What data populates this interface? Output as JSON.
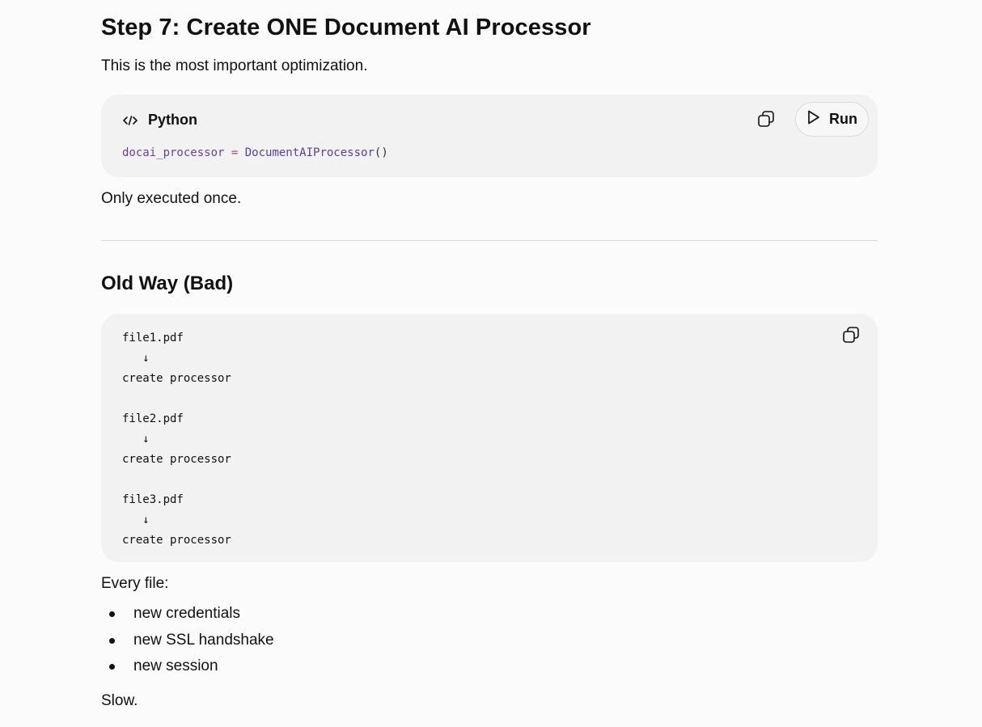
{
  "step7": {
    "title": "Step 7: Create ONE Document AI Processor",
    "intro": "This is the most important optimization.",
    "code_block": {
      "language_label": "Python",
      "language_icon": "code-icon",
      "copy_icon": "copy-icon",
      "run_label": "Run",
      "run_icon": "play-icon",
      "code_tokens": {
        "var": "docai_processor",
        "op": " = ",
        "fn": "DocumentAIProcessor",
        "punc": "()"
      }
    },
    "after_code": "Only executed once."
  },
  "old_way": {
    "title": "Old Way (Bad)",
    "code_block": {
      "copy_icon": "copy-icon",
      "lines": [
        "file1.pdf",
        "   ↓",
        "create processor",
        "",
        "file2.pdf",
        "   ↓",
        "create processor",
        "",
        "file3.pdf",
        "   ↓",
        "create processor"
      ]
    },
    "every_file_label": "Every file:",
    "bullets": [
      "new credentials",
      "new SSL handshake",
      "new session"
    ],
    "conclusion": "Slow."
  },
  "colors": {
    "background": "#fbfbfb",
    "code_background": "#f2f2f2",
    "text": "#111111",
    "code_variable": "#6b3fa0",
    "code_operator": "#b5487a",
    "code_function": "#5a3e9c"
  }
}
